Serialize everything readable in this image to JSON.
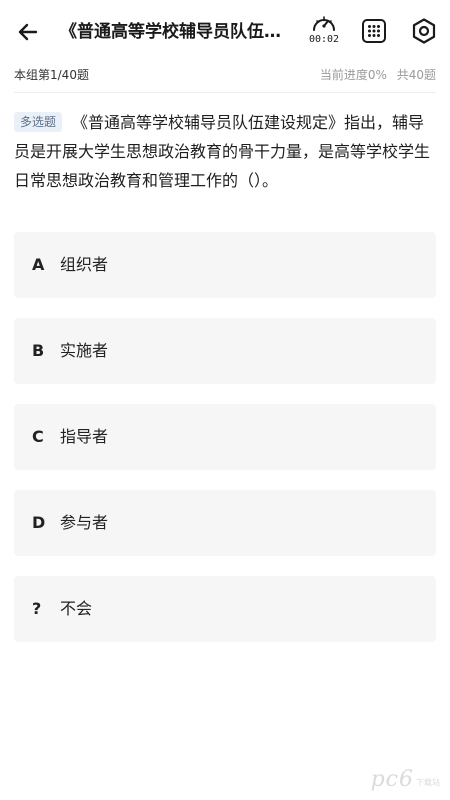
{
  "header": {
    "title": "《普通高等学校辅导员队伍建设规定》指出",
    "timer": "00:02",
    "icons": [
      "back-arrow-icon",
      "timer-gauge-icon",
      "answer-card-grid-icon",
      "settings-gear-icon"
    ]
  },
  "progress": {
    "group_index": "本组第1/40题",
    "current_progress": "当前进度0%",
    "total": "共40题"
  },
  "question": {
    "type": "多选题",
    "text": "《普通高等学校辅导员队伍建设规定》指出，辅导员是开展大学生思想政治教育的骨干力量，是高等学校学生日常思想政治教育和管理工作的（）。"
  },
  "options": [
    {
      "letter": "A",
      "text": "组织者"
    },
    {
      "letter": "B",
      "text": "实施者"
    },
    {
      "letter": "C",
      "text": "指导者"
    },
    {
      "letter": "D",
      "text": "参与者"
    },
    {
      "letter": "?",
      "text": "不会"
    }
  ],
  "watermark": {
    "text": "pc6",
    "small": "下载站"
  },
  "colors": {
    "option_bg": "#f6f6f6",
    "tag_bg": "#eaf0f8",
    "tag_text": "#5c6f8a",
    "muted_text": "#9a9a9a"
  }
}
